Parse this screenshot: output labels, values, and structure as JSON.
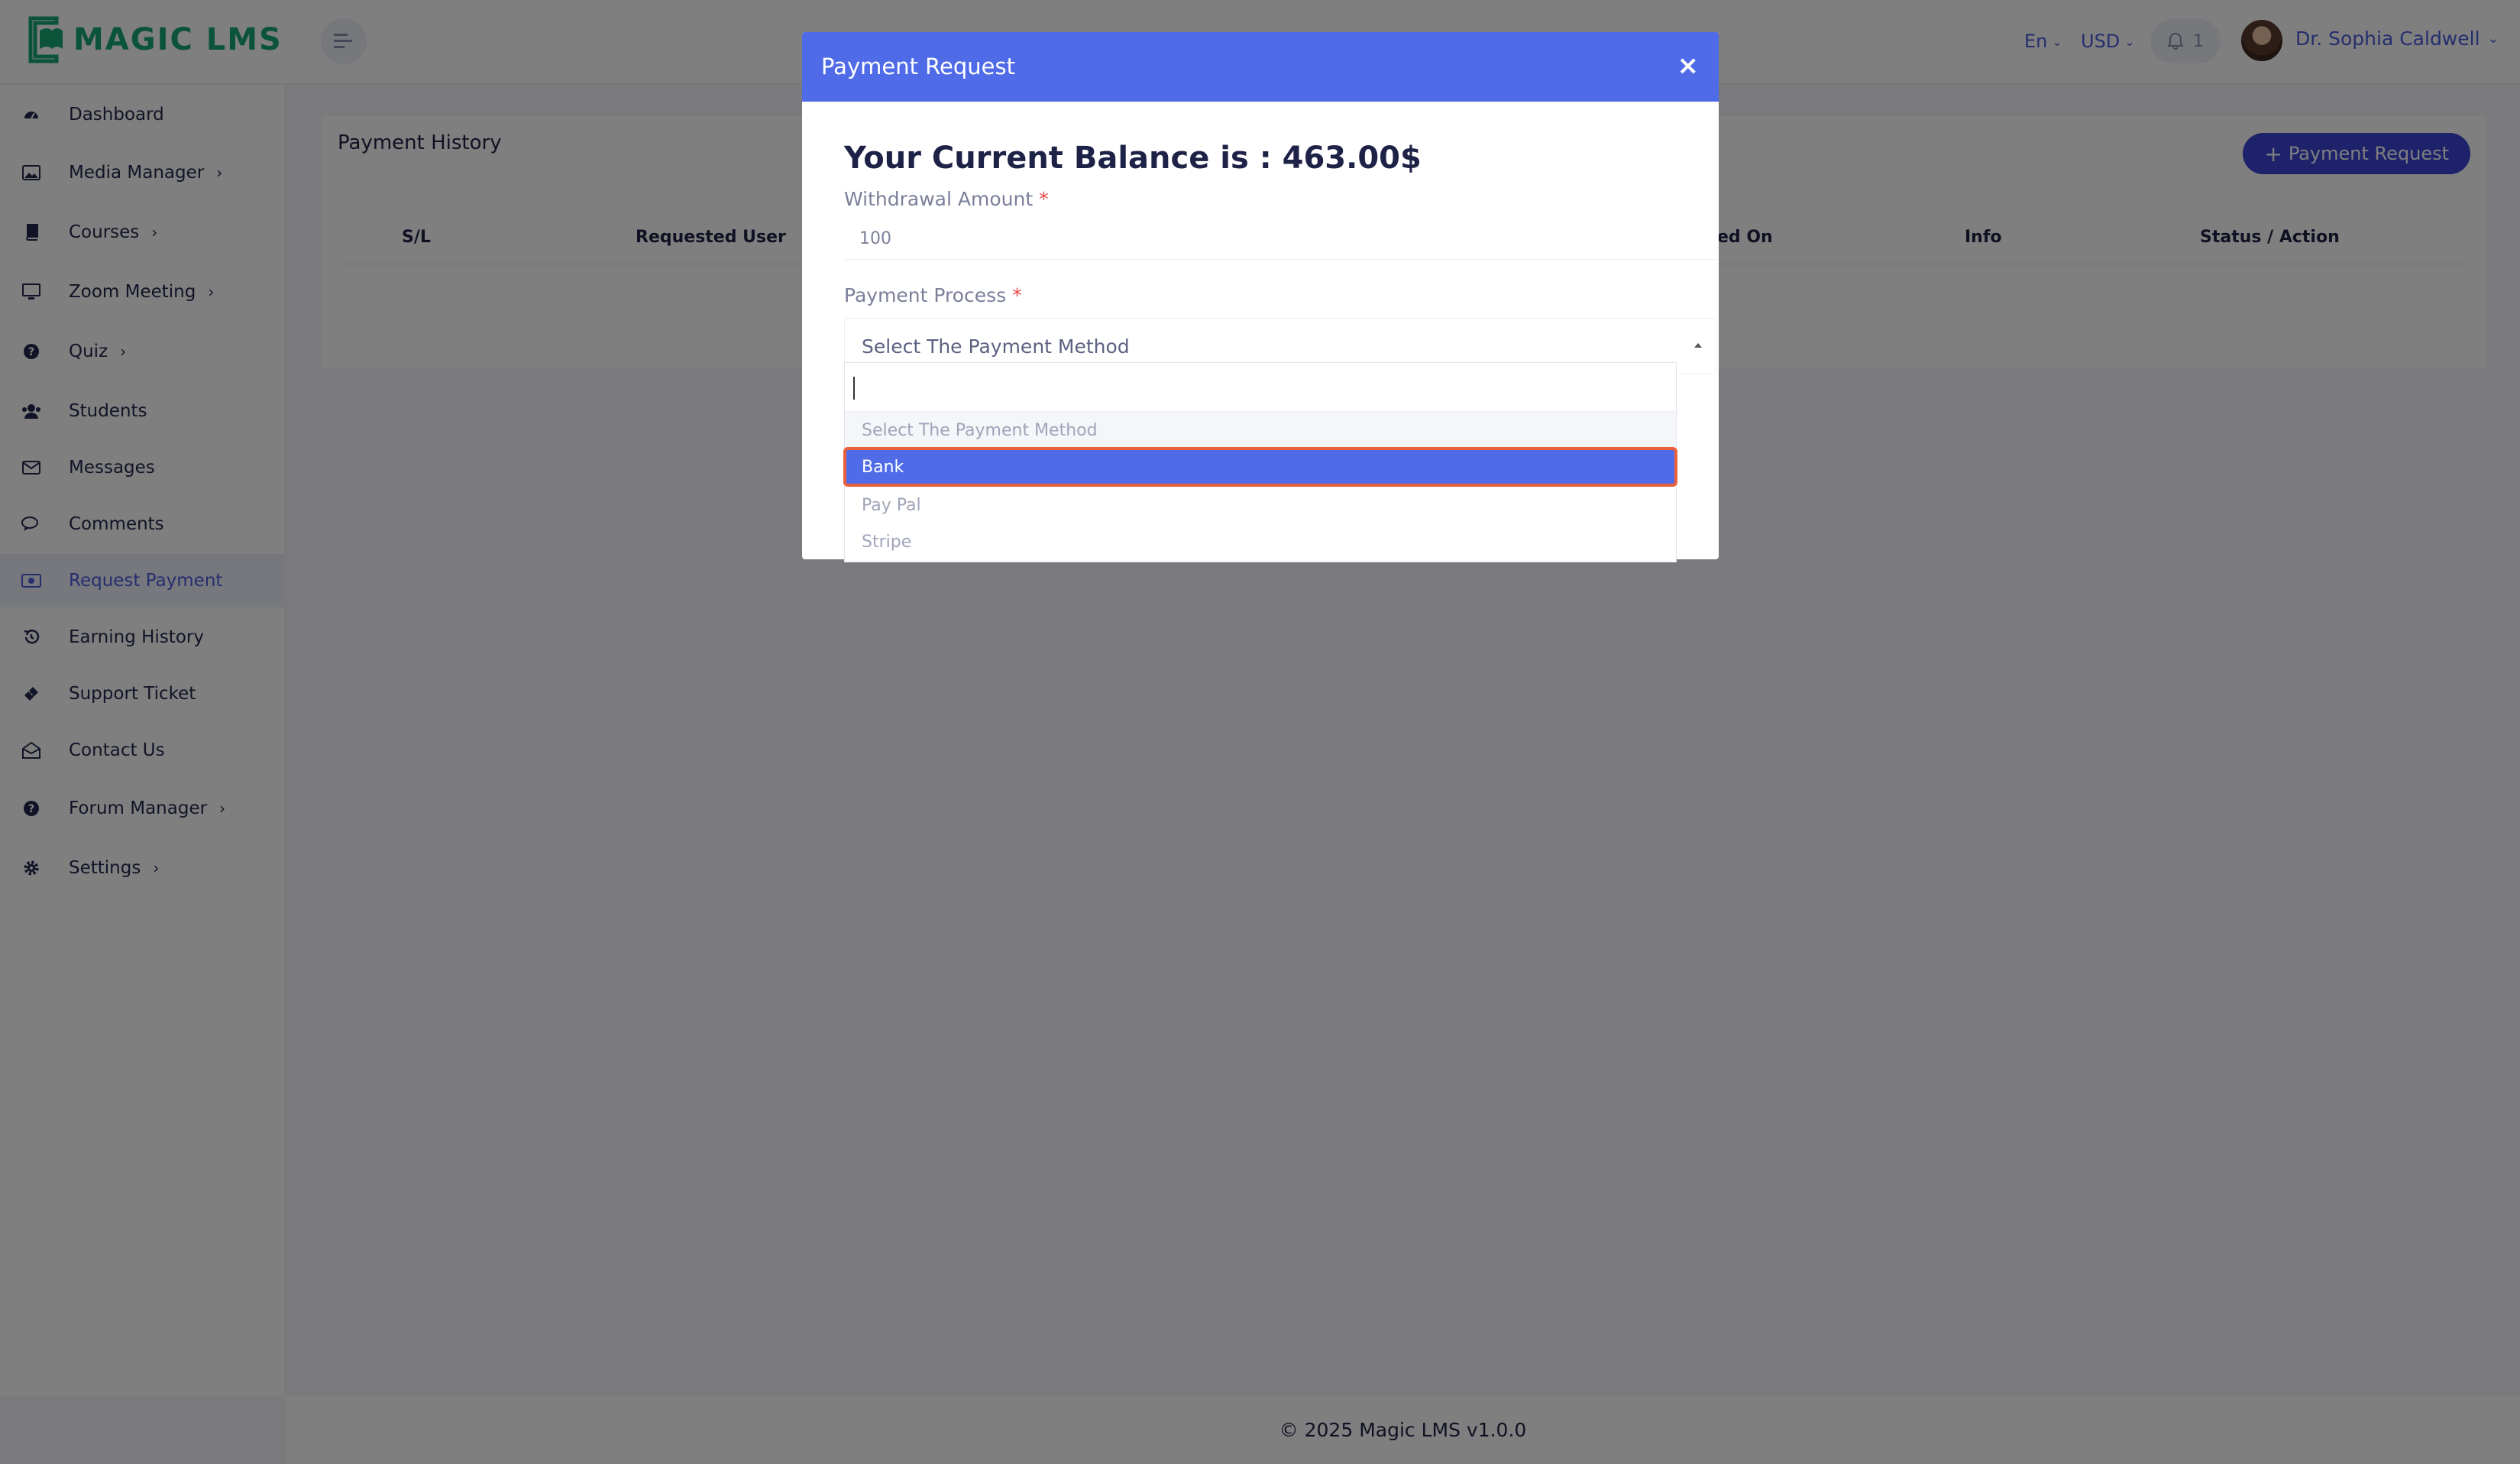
{
  "brand": {
    "name": "MAGIC LMS",
    "accent": "#17a673",
    "primary": "#4b5ddd"
  },
  "header": {
    "language": "En",
    "currency": "USD",
    "notification_count": "1",
    "user_name": "Dr. Sophia Caldwell"
  },
  "sidebar": {
    "items": [
      {
        "label": "Dashboard",
        "icon": "dashboard-icon",
        "has_children": false
      },
      {
        "label": "Media Manager",
        "icon": "image-icon",
        "has_children": true
      },
      {
        "label": "Courses",
        "icon": "book-icon",
        "has_children": true
      },
      {
        "label": "Zoom Meeting",
        "icon": "monitor-icon",
        "has_children": true
      },
      {
        "label": "Quiz",
        "icon": "question-icon",
        "has_children": true
      },
      {
        "label": "Students",
        "icon": "users-icon",
        "has_children": false
      },
      {
        "label": "Messages",
        "icon": "envelope-icon",
        "has_children": false
      },
      {
        "label": "Comments",
        "icon": "comments-icon",
        "has_children": false
      },
      {
        "label": "Request Payment",
        "icon": "money-icon",
        "has_children": false,
        "active": true
      },
      {
        "label": "Earning History",
        "icon": "history-icon",
        "has_children": false
      },
      {
        "label": "Support Ticket",
        "icon": "ticket-icon",
        "has_children": false
      },
      {
        "label": "Contact Us",
        "icon": "envelope-open-icon",
        "has_children": false
      },
      {
        "label": "Forum Manager",
        "icon": "question-icon",
        "has_children": true
      },
      {
        "label": "Settings",
        "icon": "gear-icon",
        "has_children": true
      }
    ]
  },
  "main": {
    "card_title": "Payment History",
    "payment_request_button": "Payment Request",
    "table_headers": [
      "S/L",
      "Requested User",
      "ed On",
      "Info",
      "Status / Action"
    ]
  },
  "modal": {
    "title": "Payment Request",
    "close": "×",
    "balance_text": "Your Current Balance is : 463.00$",
    "amount_label": "Withdrawal Amount",
    "amount_value": "100",
    "process_label": "Payment Process",
    "select_placeholder": "Select The Payment Method",
    "required_mark": "*"
  },
  "dropdown": {
    "options": [
      "Select The Payment Method",
      "Bank",
      "Pay Pal",
      "Stripe"
    ],
    "selected": "Bank"
  },
  "footer": {
    "text": "© 2025 Magic LMS v1.0.0"
  }
}
